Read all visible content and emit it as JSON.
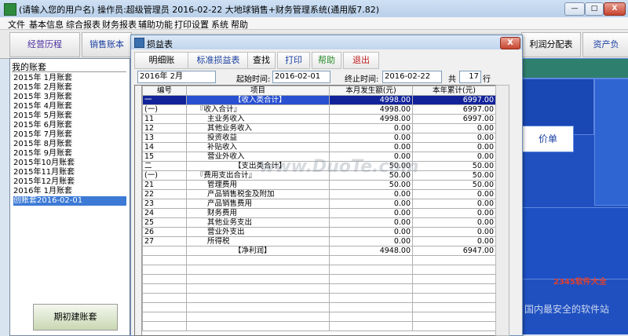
{
  "window": {
    "title": "(请输入您的用户名)   操作员:超级管理员   2016-02-22   大地球销售+财务管理系统(通用版7.82)",
    "min": "—",
    "max": "□",
    "close": "X"
  },
  "menu": [
    "文件",
    "基本信息",
    "综合报表",
    "财务报表",
    "辅助功能",
    "打印设置",
    "系统",
    "帮助"
  ],
  "toolbar": [
    "经营历程",
    "销售账本",
    "利润分配表",
    "资产负"
  ],
  "right_bg": {
    "price_label": "价单"
  },
  "left_panel": {
    "header": "我的账套",
    "items": [
      "2015年 1月账套",
      "2015年 2月账套",
      "2015年 3月账套",
      "2015年 4月账套",
      "2015年 5月账套",
      "2015年 6月账套",
      "2015年 7月账套",
      "2015年 8月账套",
      "2015年 9月账套",
      "2015年10月账套",
      "2015年11月账套",
      "2015年12月账套",
      "2016年 1月账套"
    ],
    "selected": "创账套2016-02-01",
    "init_button": "期初建账套"
  },
  "dialog": {
    "title": "损益表",
    "close": "X",
    "tabs": [
      "明细账",
      "标准损益表",
      "查找",
      "打印",
      "帮助",
      "退出"
    ],
    "period": "2016年 2月",
    "start_label": "起始时间:",
    "start": "2016-02-01",
    "end_label": "终止时间:",
    "end": "2016-02-22",
    "total_label": "共",
    "total": "17",
    "rows_label": "行"
  },
  "table": {
    "headers": [
      "编号",
      "项目",
      "本月发生额(元)",
      "本年累计(元)"
    ],
    "rows": [
      [
        "一",
        "【收入类合计】",
        "4998.00",
        "6997.00"
      ],
      [
        "(一)",
        "『收入合计』",
        "4998.00",
        "6997.00"
      ],
      [
        "11",
        "主业务收入",
        "4998.00",
        "6997.00"
      ],
      [
        "12",
        "其他业务收入",
        "0.00",
        "0.00"
      ],
      [
        "13",
        "投资收益",
        "0.00",
        "0.00"
      ],
      [
        "14",
        "补贴收入",
        "0.00",
        "0.00"
      ],
      [
        "15",
        "营业外收入",
        "0.00",
        "0.00"
      ],
      [
        "二",
        "【支出类合计】",
        "50.00",
        "50.00"
      ],
      [
        "(一)",
        "『费用支出合计』",
        "50.00",
        "50.00"
      ],
      [
        "21",
        "管理费用",
        "50.00",
        "50.00"
      ],
      [
        "22",
        "产品销售税金及附加",
        "0.00",
        "0.00"
      ],
      [
        "23",
        "产品销售费用",
        "0.00",
        "0.00"
      ],
      [
        "24",
        "财务费用",
        "0.00",
        "0.00"
      ],
      [
        "25",
        "其他业务支出",
        "0.00",
        "0.00"
      ],
      [
        "26",
        "营业外支出",
        "0.00",
        "0.00"
      ],
      [
        "27",
        "所得税",
        "0.00",
        "0.00"
      ],
      [
        "",
        "【净利润】",
        "4948.00",
        "6947.00"
      ]
    ]
  },
  "watermarks": [
    "www.DuoTe.com",
    "国内最安全的软件站",
    "2345软件大全"
  ]
}
